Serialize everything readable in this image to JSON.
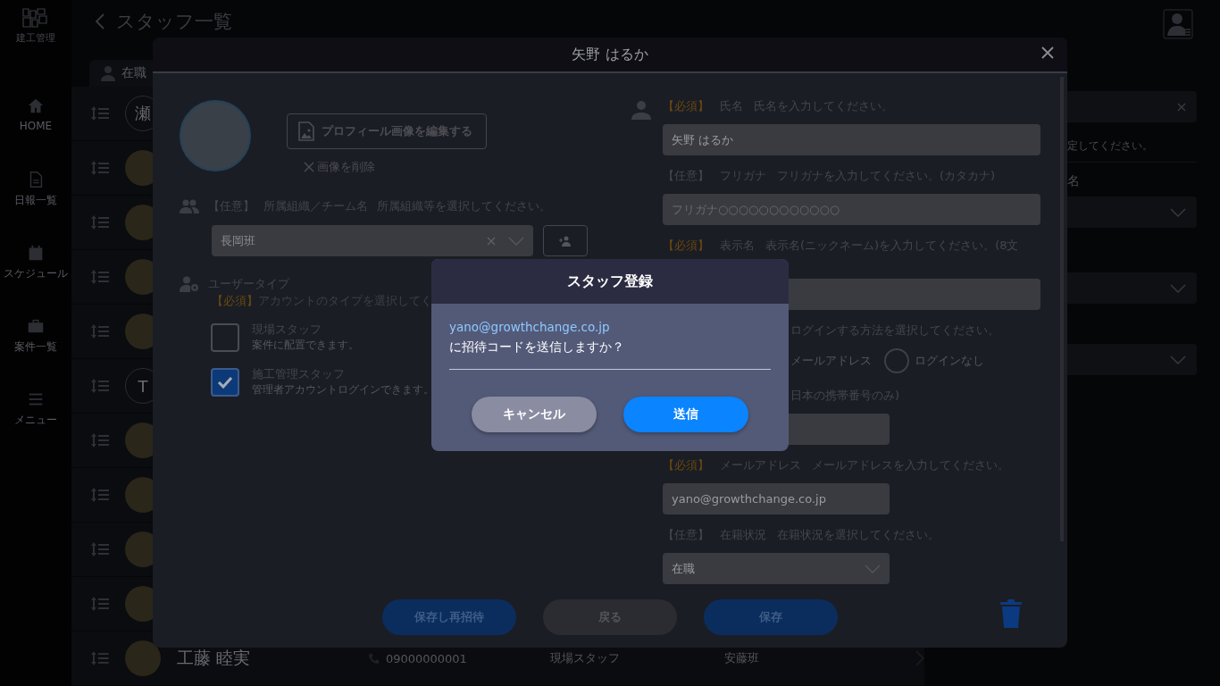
{
  "sidebar": {
    "logo": "建工管理",
    "items": [
      {
        "label": "HOME"
      },
      {
        "label": "日報一覧"
      },
      {
        "label": "スケジュール"
      },
      {
        "label": "案件一覧"
      },
      {
        "label": "メニュー"
      }
    ]
  },
  "header": {
    "title": "スタッフ一覧"
  },
  "tab": {
    "label": "在職"
  },
  "staff_rows": [
    {
      "kind": "letter",
      "initial": "瀬"
    },
    {
      "kind": "photo"
    },
    {
      "kind": "photo"
    },
    {
      "kind": "photo"
    },
    {
      "kind": "photo"
    },
    {
      "kind": "letter",
      "initial": "T"
    },
    {
      "kind": "photo"
    },
    {
      "kind": "photo"
    },
    {
      "kind": "photo"
    },
    {
      "kind": "photo"
    },
    {
      "kind": "photo",
      "name": "工藤 睦実",
      "phone": "09000000001",
      "user_type": "現場スタッフ",
      "team": "安藤班"
    }
  ],
  "filter_panel": {
    "hint": "定してください。",
    "label": "名"
  },
  "modal": {
    "title": "矢野 はるか",
    "profile": {
      "edit_button": "プロフィール画像を編集する",
      "delete_link": "画像を削除"
    },
    "team": {
      "tag": "【任意】",
      "required": false,
      "label": "所属組織／チーム名",
      "hint": "所属組織等を選択してください。",
      "value": "長岡班"
    },
    "user_type": {
      "label": "ユーザータイプ",
      "tag": "【必須】",
      "required": true,
      "hint": "アカウントのタイプを選択してく",
      "options": [
        {
          "label": "現場スタッフ",
          "description": "案件に配置できます。",
          "checked": false
        },
        {
          "label": "施工管理スタッフ",
          "description": "管理者アカウントログインできます。",
          "checked": true
        }
      ]
    },
    "fields": [
      {
        "kind": "text",
        "tag": "【必須】",
        "required": true,
        "label": "氏名",
        "hint": "氏名を入力してください。",
        "value": "矢野 はるか"
      },
      {
        "kind": "text",
        "tag": "【任意】",
        "required": false,
        "label": "フリガナ",
        "hint": "フリガナを入力してください。(カタカナ)",
        "placeholder": "フリガナ○○○○○○○○○○○○"
      },
      {
        "kind": "text",
        "tag": "【必須】",
        "required": true,
        "label": "表示名",
        "hint": "表示名(ニックネーム)を入力してください。(8文"
      },
      {
        "kind": "radio",
        "hint": "ログインする方法を選択してください。",
        "options": [
          {
            "label": "メールアドレス"
          },
          {
            "label": "ログインなし",
            "selected": false
          }
        ]
      },
      {
        "kind": "text",
        "hint": "日本の携帯番号のみ)"
      },
      {
        "kind": "text",
        "tag": "【必須】",
        "required": true,
        "label": "メールアドレス",
        "hint": "メールアドレスを入力してください。",
        "value": "yano@growthchange.co.jp"
      },
      {
        "kind": "select",
        "tag": "【任意】",
        "required": false,
        "label": "在籍状況",
        "hint": "在籍状況を選択してください。",
        "value": "在職"
      }
    ],
    "buttons": [
      {
        "label": "保存し再招待",
        "kind": "primary"
      },
      {
        "label": "戻る",
        "kind": "secondary"
      },
      {
        "label": "保存",
        "kind": "primary"
      }
    ]
  },
  "dialog": {
    "title": "スタッフ登録",
    "email": "yano@growthchange.co.jp",
    "message": "に招待コードを送信しますか？",
    "buttons": [
      {
        "label": "キャンセル",
        "kind": "cancel"
      },
      {
        "label": "送信",
        "kind": "primary"
      }
    ]
  }
}
